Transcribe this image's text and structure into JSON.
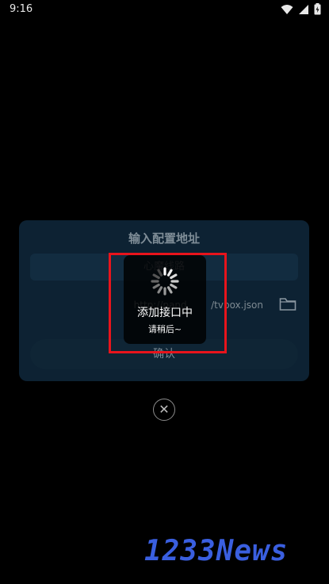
{
  "status_bar": {
    "time": "9:16",
    "icons": [
      "wifi-icon",
      "signal-icon",
      "battery-icon"
    ]
  },
  "dialog": {
    "title": "输入配置地址",
    "line_selector_label": "心魔线路",
    "url_value": "http://pand        /tvbox.json",
    "folder_icon": "folder-icon",
    "confirm_label": "确认"
  },
  "loading": {
    "title": "添加接口中",
    "subtitle": "请稍后~"
  },
  "close_icon": "close-icon",
  "watermark": "1233News",
  "colors": {
    "background": "#000000",
    "dialog_bg": "#0d2233",
    "highlight": "#e8141c",
    "watermark": "#3a5fe0"
  }
}
